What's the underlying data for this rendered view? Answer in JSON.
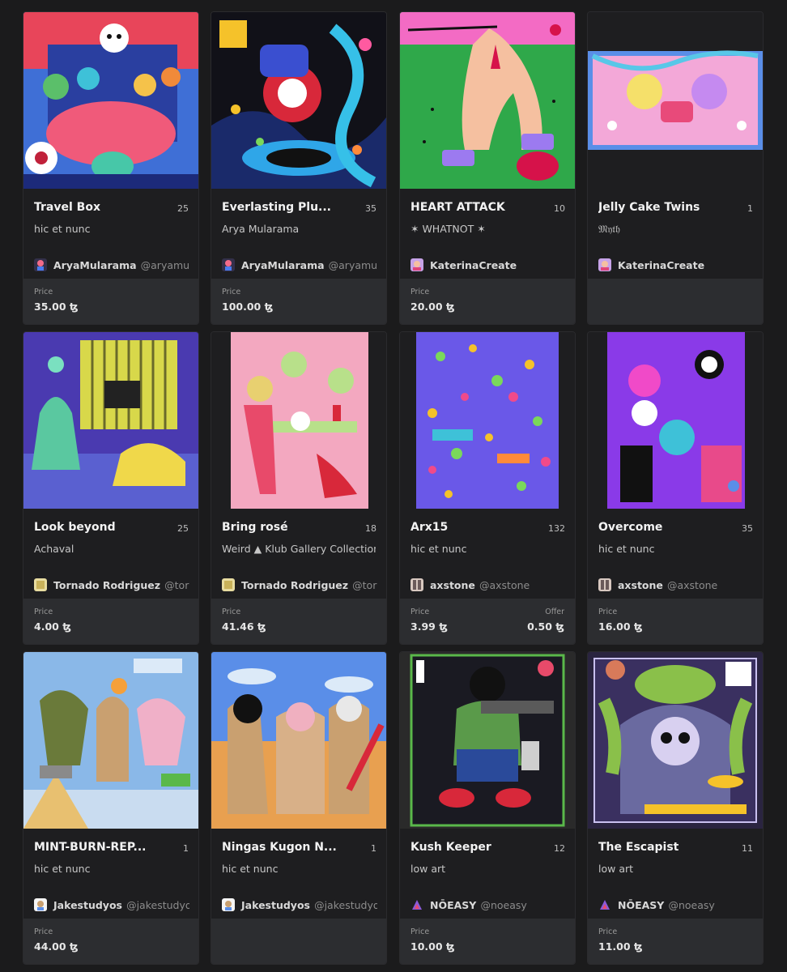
{
  "price_label": "Price",
  "offer_label": "Offer",
  "cards": [
    {
      "title": "Travel Box",
      "count": "25",
      "collection": "hic et nunc",
      "creator": "AryaMularama",
      "handle": "@aryamularama",
      "price": "35.00 ꜩ",
      "art": "travel-box-artwork"
    },
    {
      "title": "Everlasting Plu...",
      "count": "35",
      "collection": "Arya Mularama",
      "creator": "AryaMularama",
      "handle": "@aryamularama",
      "price": "100.00 ꜩ",
      "art": "everlasting-artwork"
    },
    {
      "title": "HEART ATTACK",
      "count": "10",
      "collection": "✶ WHATNOT ✶",
      "creator": "KaterinaCreate",
      "handle": "",
      "price": "20.00 ꜩ",
      "art": "heart-attack-artwork"
    },
    {
      "title": "Jelly Cake Twins",
      "count": "1",
      "collection": "𝔐𝔶𝔱𝔥",
      "creator": "KaterinaCreate",
      "handle": "",
      "price": "",
      "art": "jelly-cake-artwork"
    },
    {
      "title": "Look beyond",
      "count": "25",
      "collection": "Achaval",
      "creator": "Tornado Rodriguez",
      "handle": "@tornado",
      "price": "4.00 ꜩ",
      "art": "look-beyond-artwork"
    },
    {
      "title": "Bring rosé",
      "count": "18",
      "collection": "Weird ▲ Klub Gallery Collection",
      "creator": "Tornado Rodriguez",
      "handle": "@tornado",
      "price": "41.46 ꜩ",
      "art": "bring-rose-artwork"
    },
    {
      "title": "Arx15",
      "count": "132",
      "collection": "hic et nunc",
      "creator": "axstone",
      "handle": "@axstone",
      "price": "3.99 ꜩ",
      "offer": "0.50 ꜩ",
      "art": "arx15-artwork"
    },
    {
      "title": "Overcome",
      "count": "35",
      "collection": "hic et nunc",
      "creator": "axstone",
      "handle": "@axstone",
      "price": "16.00 ꜩ",
      "art": "overcome-artwork"
    },
    {
      "title": "MINT-BURN-REP...",
      "count": "1",
      "collection": "hic et nunc",
      "creator": "Jakestudyos",
      "handle": "@jakestudyos",
      "price": "44.00 ꜩ",
      "art": "mint-burn-artwork"
    },
    {
      "title": "Ningas Kugon N...",
      "count": "1",
      "collection": "hic et nunc",
      "creator": "Jakestudyos",
      "handle": "@jakestudyos",
      "price": "",
      "art": "ningas-artwork"
    },
    {
      "title": "Kush Keeper",
      "count": "12",
      "collection": "low art",
      "creator": "NŌEASY",
      "handle": "@noeasy",
      "price": "10.00 ꜩ",
      "art": "kush-keeper-artwork"
    },
    {
      "title": "The Escapist",
      "count": "11",
      "collection": "low art",
      "creator": "NŌEASY",
      "handle": "@noeasy",
      "price": "11.00 ꜩ",
      "art": "escapist-artwork"
    }
  ],
  "colors": {
    "background": "#1b1b1c",
    "card": "#1e1e20",
    "price_panel": "#2c2d30",
    "title": "#f2f2f2"
  }
}
